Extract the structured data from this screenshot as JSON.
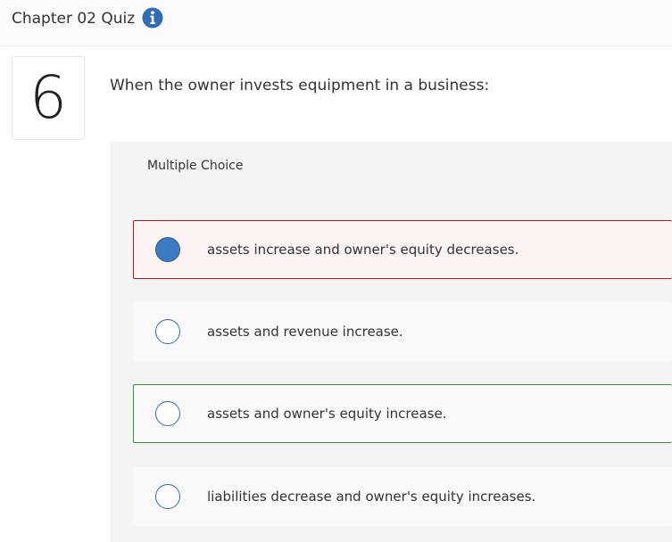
{
  "header": {
    "title": "Chapter 02 Quiz",
    "info_icon": "info-icon"
  },
  "question": {
    "number": "6",
    "text": "When the owner invests equipment in a business:"
  },
  "multiple_choice": {
    "label": "Multiple Choice",
    "options": [
      {
        "text": "assets increase and owner's equity decreases.",
        "selected": true,
        "status": "incorrect"
      },
      {
        "text": "assets and revenue increase.",
        "selected": false,
        "status": "none"
      },
      {
        "text": "assets and owner's equity increase.",
        "selected": false,
        "status": "correct"
      },
      {
        "text": "liabilities decrease and owner's equity increases.",
        "selected": false,
        "status": "none"
      }
    ]
  },
  "colors": {
    "accent_blue": "#3b7bc4",
    "incorrect_border": "#a31c24",
    "correct_border": "#3b8a3e"
  }
}
